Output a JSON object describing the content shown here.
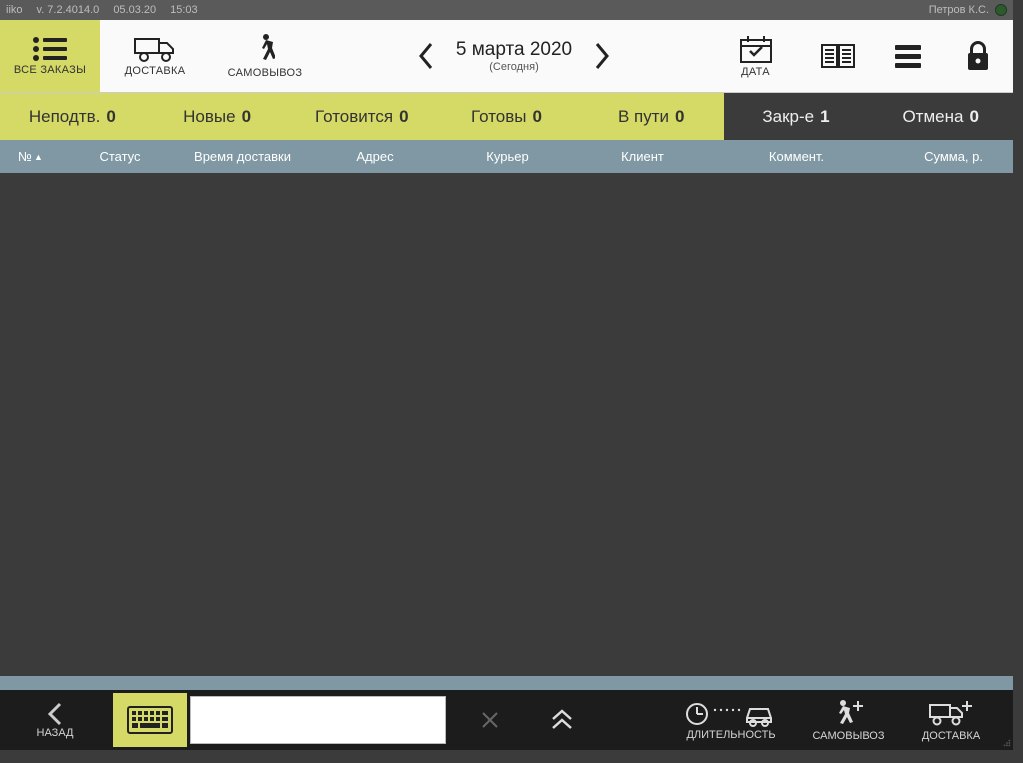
{
  "titlebar": {
    "app": "iiko",
    "version": "v. 7.2.4014.0",
    "date": "05.03.20",
    "time": "15:03",
    "user": "Петров К.С."
  },
  "toolbar": {
    "all_orders": "ВСЕ ЗАКАЗЫ",
    "delivery": "ДОСТАВКА",
    "pickup": "САМОВЫВОЗ",
    "date_label": "ДАТА",
    "date_value": "5 марта 2020",
    "date_today": "(Сегодня)"
  },
  "filters": [
    {
      "label": "Неподтв.",
      "count": "0",
      "tone": "light"
    },
    {
      "label": "Новые",
      "count": "0",
      "tone": "light"
    },
    {
      "label": "Готовится",
      "count": "0",
      "tone": "light"
    },
    {
      "label": "Готовы",
      "count": "0",
      "tone": "light"
    },
    {
      "label": "В пути",
      "count": "0",
      "tone": "light"
    },
    {
      "label": "Закр-е",
      "count": "1",
      "tone": "dark"
    },
    {
      "label": "Отмена",
      "count": "0",
      "tone": "dark"
    }
  ],
  "columns": {
    "num": "№",
    "status": "Статус",
    "time": "Время доставки",
    "address": "Адрес",
    "courier": "Курьер",
    "client": "Клиент",
    "comment": "Коммент.",
    "sum": "Сумма, р."
  },
  "footer": {
    "back": "НАЗАД",
    "duration": "ДЛИТЕЛЬНОСТЬ",
    "pickup": "САМОВЫВОЗ",
    "delivery": "ДОСТАВКА",
    "search_value": ""
  }
}
